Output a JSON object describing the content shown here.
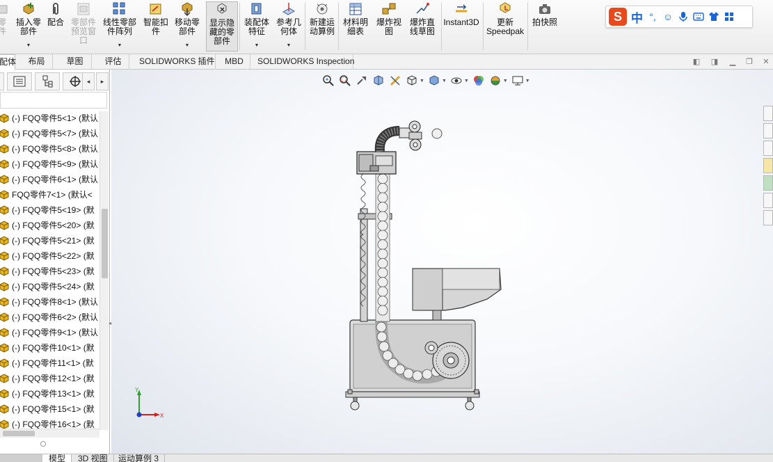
{
  "ribbon": {
    "cut_left_label": "零\n件",
    "insert_part": "插入零\n部件",
    "mate": "配合",
    "preview_window": "零部件\n预览窗\n口",
    "linear_pattern": "线性零部\n件阵列",
    "smart_fasteners": "智能扣\n件",
    "move_component": "移动零\n部件",
    "show_hidden": "显示隐\n藏的零\n部件",
    "assembly_features": "装配体\n特征",
    "reference_geometry": "参考几\n何体",
    "new_motion_study": "新建运\n动算例",
    "bom": "材料明\n细表",
    "exploded_view": "爆炸视\n图",
    "explode_line_sketch": "爆炸直\n线草图",
    "instant3d": "Instant3D",
    "update_speedpak": "更新\nSpeedpak",
    "take_snapshot": "拍快照"
  },
  "ime": {
    "logo": "S",
    "mode": "中",
    "punct": "°,"
  },
  "tabs": {
    "assembly": "配体",
    "layout": "布局",
    "sketch": "草图",
    "evaluate": "评估",
    "sw_addins": "SOLIDWORKS 插件",
    "mbd": "MBD",
    "inspection": "SOLIDWORKS Inspection"
  },
  "tree": [
    "(-) FQQ零件5<1> (默认",
    "(-) FQQ零件5<7> (默认",
    "(-) FQQ零件5<8> (默认",
    "(-) FQQ零件5<9> (默认",
    "(-) FQQ零件6<1> (默认",
    "FQQ零件7<1> (默认<",
    "(-) FQQ零件5<19> (默",
    "(-) FQQ零件5<20> (默",
    "(-) FQQ零件5<21> (默",
    "(-) FQQ零件5<22> (默",
    "(-) FQQ零件5<23> (默",
    "(-) FQQ零件5<24> (默",
    "(-) FQQ零件8<1> (默认",
    "(-) FQQ零件6<2> (默认",
    "(-) FQQ零件9<1> (默认",
    "(-) FQQ零件10<1> (默",
    "(-) FQQ零件11<1> (默",
    "(-) FQQ零件12<1> (默",
    "(-) FQQ零件13<1> (默",
    "(-) FQQ零件15<1> (默",
    "(-) FQQ零件16<1> (默"
  ],
  "triad": {
    "y": "Y",
    "x": "X"
  },
  "bottom_tabs": {
    "model": "模型",
    "view3d": "3D 视图",
    "motion_study": "运动算例 3"
  },
  "colors": {
    "accent_blue": "#1a66d6",
    "ime_logo": "#e8491d",
    "part_icon": "#e8b51a"
  }
}
